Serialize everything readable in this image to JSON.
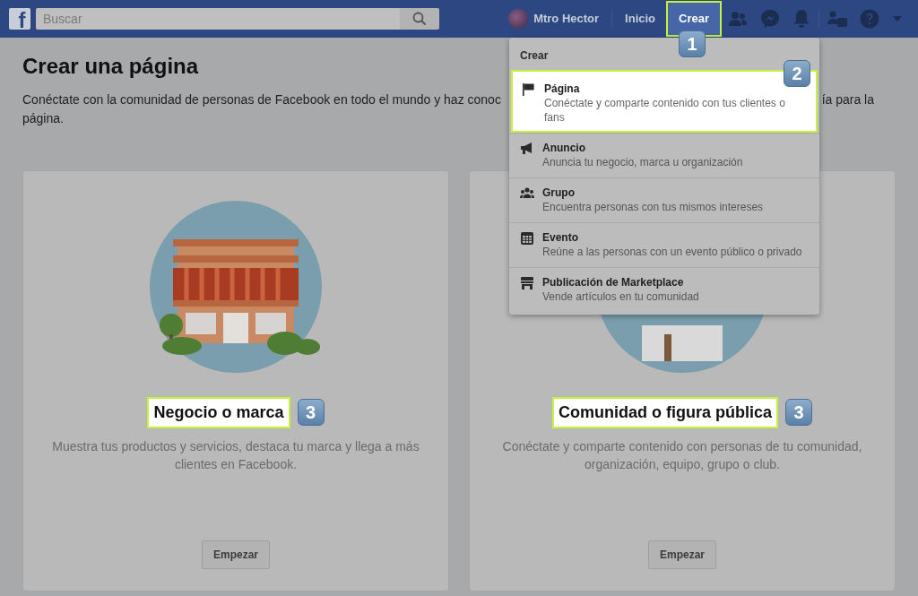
{
  "header": {
    "logo": "f",
    "search": {
      "placeholder": "Buscar"
    },
    "profile": {
      "name": "Mtro Hector"
    },
    "nav": [
      {
        "label": "Inicio",
        "selected": false,
        "highlighted": false
      },
      {
        "label": "Crear",
        "selected": true,
        "highlighted": true,
        "callout": "1"
      }
    ]
  },
  "page": {
    "title": "Crear una página",
    "description": {
      "line1_start": "Conéctate con la comunidad de personas de Facebook en todo el mundo y haz conoc",
      "line1_end": "ía para la",
      "line2": "página."
    }
  },
  "cards": [
    {
      "kind": "store",
      "title": "Negocio o marca",
      "highlighted": true,
      "callout": "3",
      "text": "Muestra tus productos y servicios, destaca tu marca y llega a más clientes en Facebook.",
      "button": "Empezar"
    },
    {
      "kind": "community",
      "title": "Comunidad o figura pública",
      "highlighted": true,
      "callout": "3",
      "text": "Conéctate y comparte contenido con personas de tu comunidad, organización, equipo, grupo o club.",
      "button": "Empezar"
    }
  ],
  "menu": {
    "heading": "Crear",
    "items": [
      {
        "kind": "flag",
        "title": "Página",
        "subtitle": "Conéctate y comparte contenido con tus clientes o fans",
        "highlighted": true,
        "callout": "2"
      },
      {
        "kind": "megaphone",
        "title": "Anuncio",
        "subtitle": "Anuncia tu negocio, marca u organización",
        "highlighted": false
      },
      {
        "kind": "group",
        "title": "Grupo",
        "subtitle": "Encuentra personas con tus mismos intereses",
        "highlighted": false
      },
      {
        "kind": "calendar",
        "title": "Evento",
        "subtitle": "Reúne a las personas con un evento público o privado",
        "highlighted": false
      },
      {
        "kind": "shop",
        "title": "Publicación de Marketplace",
        "subtitle": "Vende artículos en tu comunidad",
        "highlighted": false
      }
    ]
  }
}
